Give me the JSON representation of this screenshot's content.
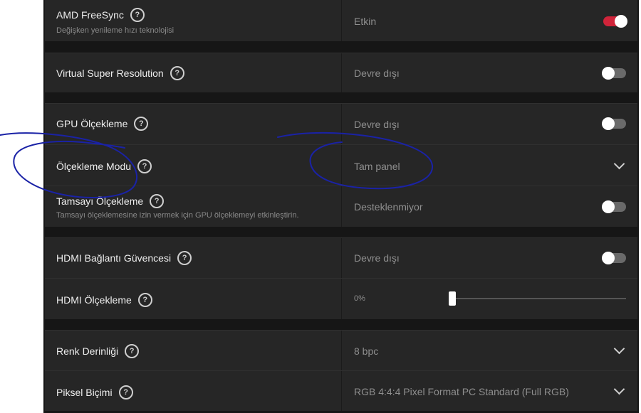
{
  "colors": {
    "accent": "#d0243a",
    "row_bg": "#262626",
    "panel_bg": "#161616",
    "annotation": "#1a22a6"
  },
  "rows": [
    {
      "label": "AMD FreeSync",
      "sub": "Değişken yenileme hızı teknolojisi",
      "value": "Etkin",
      "control": "toggle",
      "state": "on"
    },
    {
      "label": "Virtual Super Resolution",
      "value": "Devre dışı",
      "control": "toggle",
      "state": "off"
    },
    {
      "label": "GPU Ölçekleme",
      "value": "Devre dışı",
      "control": "toggle",
      "state": "off"
    },
    {
      "label": "Ölçekleme Modu",
      "value": "Tam panel",
      "control": "dropdown"
    },
    {
      "label": "Tamsayı Ölçekleme",
      "sub": "Tamsayı ölçeklemesine izin vermek için GPU ölçeklemeyi etkinleştirin.",
      "value": "Desteklenmiyor",
      "control": "toggle",
      "state": "off"
    },
    {
      "label": "HDMI Bağlantı Güvencesi",
      "value": "Devre dışı",
      "control": "toggle",
      "state": "off"
    },
    {
      "label": "HDMI Ölçekleme",
      "value": "0%",
      "control": "slider",
      "slider_value": 0
    },
    {
      "label": "Renk Derinliği",
      "value": "8 bpc",
      "control": "dropdown"
    },
    {
      "label": "Piksel Biçimi",
      "value": "RGB 4:4:4 Pixel Format PC Standard (Full RGB)",
      "control": "dropdown"
    }
  ],
  "icons": {
    "help": "question-circle-icon",
    "dropdown": "chevron-down-icon"
  },
  "help_glyph": "?"
}
